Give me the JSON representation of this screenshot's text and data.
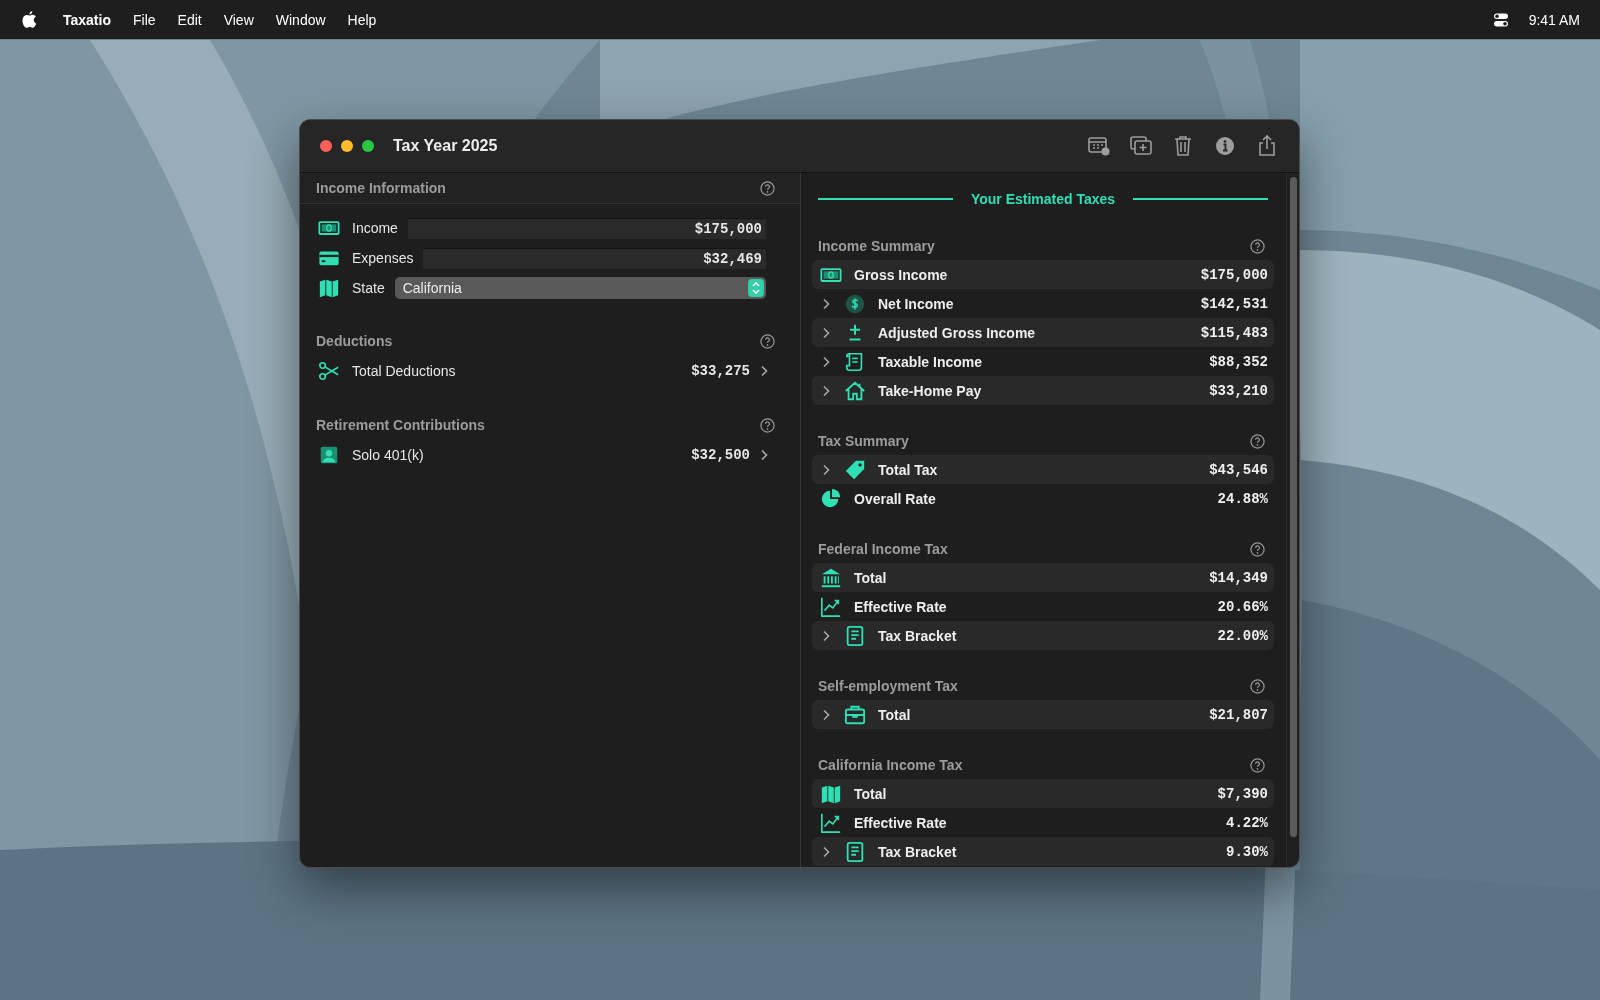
{
  "menu_bar": {
    "app_name": "Taxatio",
    "menus": [
      "File",
      "Edit",
      "View",
      "Window",
      "Help"
    ],
    "clock": "9:41 AM"
  },
  "window": {
    "title": "Tax Year 2025"
  },
  "income_information": {
    "title": "Income Information",
    "fields": [
      {
        "label": "Income",
        "value": "$175,000"
      },
      {
        "label": "Expenses",
        "value": "$32,469"
      }
    ],
    "state": {
      "label": "State",
      "value": "California"
    }
  },
  "left_sections": [
    {
      "title": "Deductions",
      "rows": [
        {
          "label": "Total Deductions",
          "value": "$33,275"
        }
      ]
    },
    {
      "title": "Retirement Contributions",
      "rows": [
        {
          "label": "Solo 401(k)",
          "value": "$32,500"
        }
      ]
    }
  ],
  "results": {
    "title": "Your Estimated Taxes",
    "sections": [
      {
        "title": "Income Summary",
        "rows": [
          {
            "label": "Gross Income",
            "value": "$175,000",
            "expandable": false
          },
          {
            "label": "Net Income",
            "value": "$142,531",
            "expandable": true
          },
          {
            "label": "Adjusted Gross Income",
            "value": "$115,483",
            "expandable": true
          },
          {
            "label": "Taxable Income",
            "value": "$88,352",
            "expandable": true
          },
          {
            "label": "Take-Home Pay",
            "value": "$33,210",
            "expandable": true
          }
        ]
      },
      {
        "title": "Tax Summary",
        "rows": [
          {
            "label": "Total Tax",
            "value": "$43,546",
            "expandable": true
          },
          {
            "label": "Overall Rate",
            "value": "24.88%",
            "expandable": false
          }
        ]
      },
      {
        "title": "Federal Income Tax",
        "rows": [
          {
            "label": "Total",
            "value": "$14,349",
            "expandable": false
          },
          {
            "label": "Effective Rate",
            "value": "20.66%",
            "expandable": false
          },
          {
            "label": "Tax Bracket",
            "value": "22.00%",
            "expandable": true
          }
        ]
      },
      {
        "title": "Self-employment Tax",
        "rows": [
          {
            "label": "Total",
            "value": "$21,807",
            "expandable": true
          }
        ]
      },
      {
        "title": "California Income Tax",
        "rows": [
          {
            "label": "Total",
            "value": "$7,390",
            "expandable": false
          },
          {
            "label": "Effective Rate",
            "value": "4.22%",
            "expandable": false
          },
          {
            "label": "Tax Bracket",
            "value": "9.30%",
            "expandable": true
          }
        ]
      }
    ]
  }
}
